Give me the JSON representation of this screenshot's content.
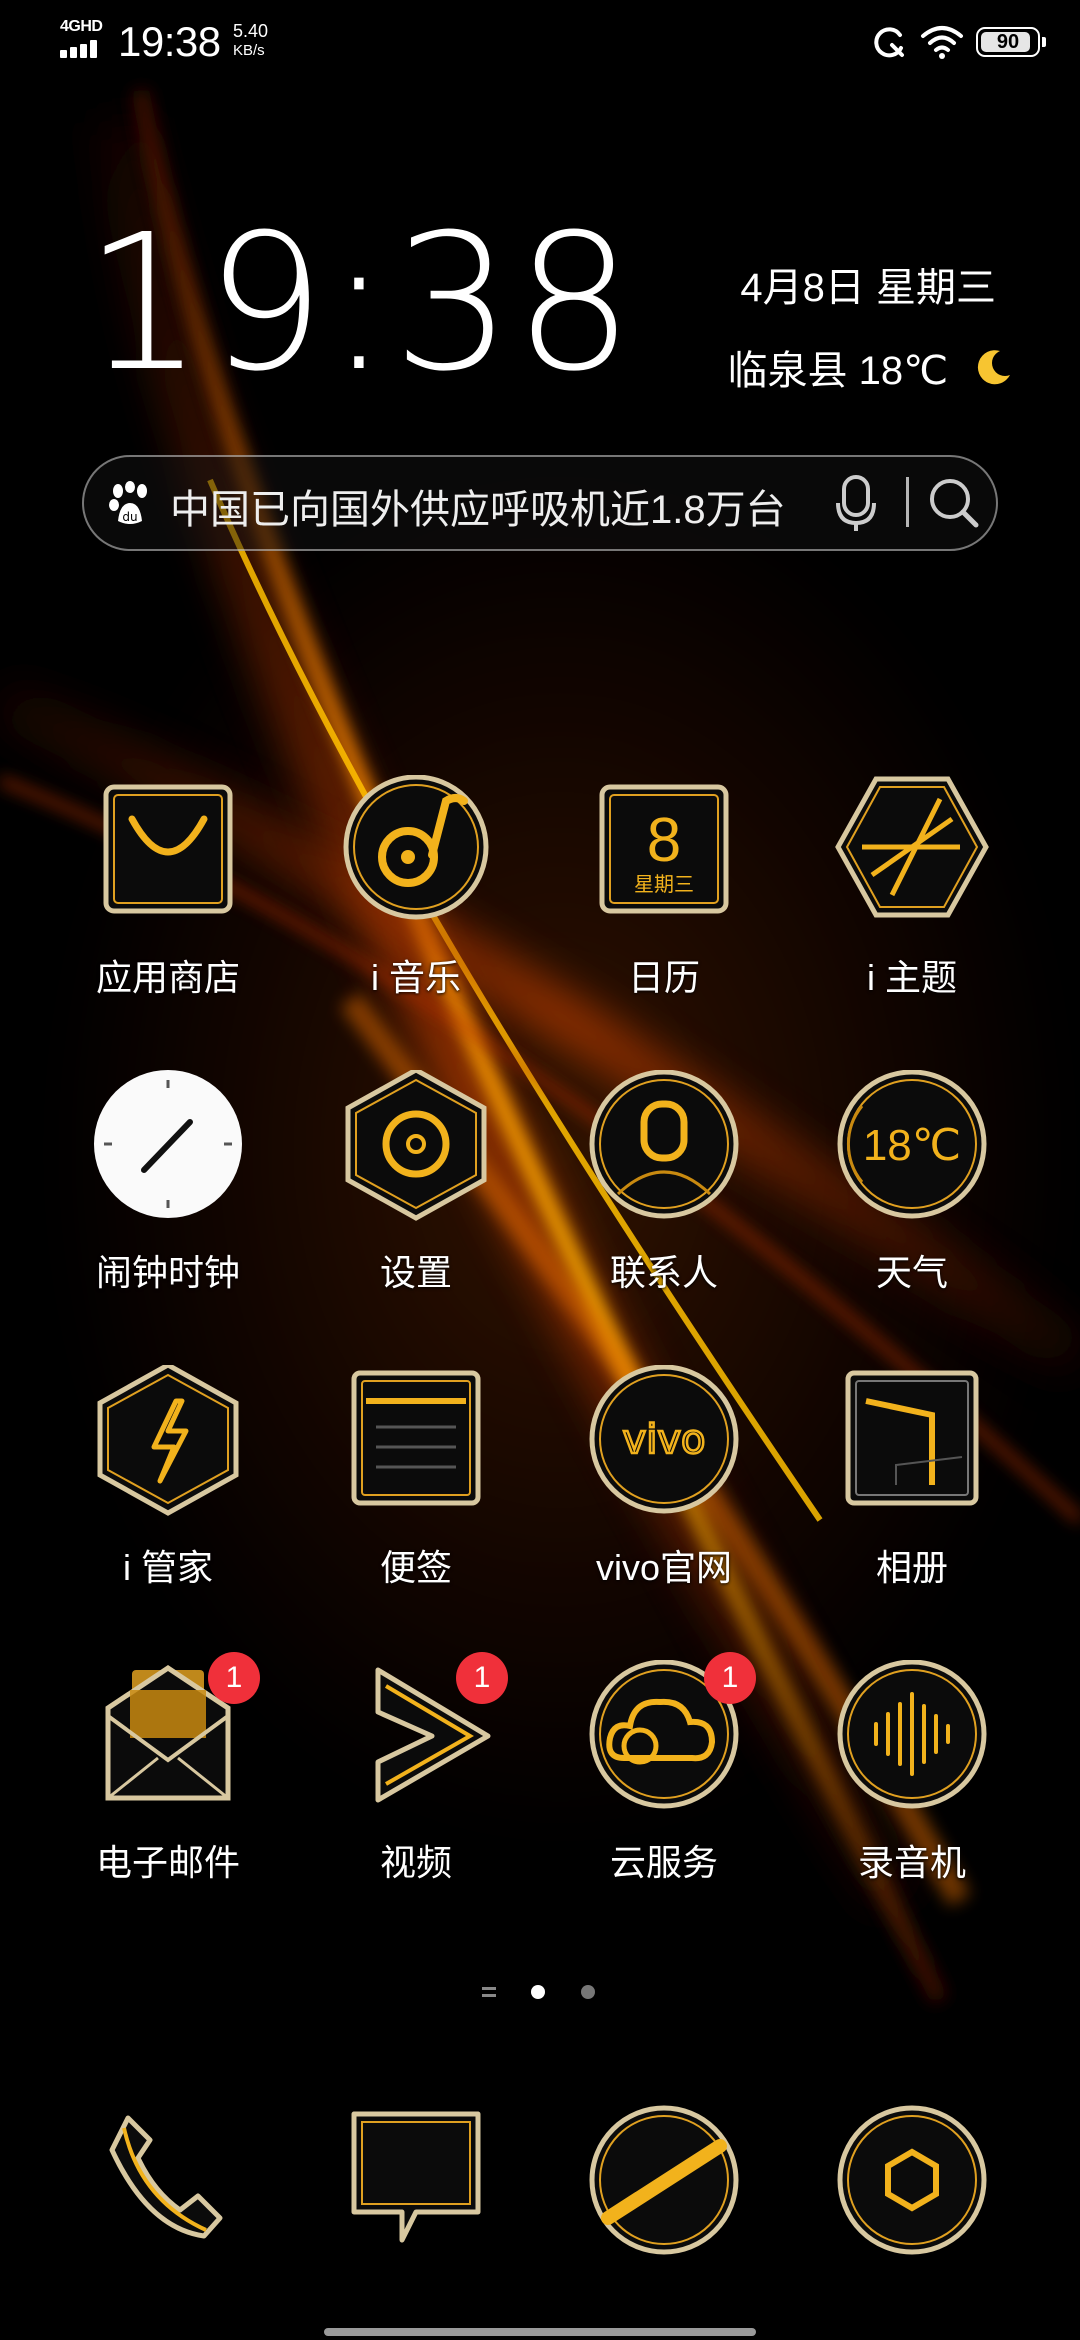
{
  "status_bar": {
    "network_type": "4GHD",
    "time": "19:38",
    "net_speed_value": "5.40",
    "net_speed_unit": "KB/s",
    "battery_level": 90,
    "battery_text": "90"
  },
  "clock_widget": {
    "time": "19:38",
    "date": "4月8日 星期三",
    "location_weather": "临泉县 18℃",
    "weather_icon": "moon-icon"
  },
  "search": {
    "query": "中国已向国外供应呼吸机近1.8万台",
    "left_icon": "baidu-paw-icon",
    "voice_icon": "microphone-icon",
    "search_icon": "search-icon"
  },
  "apps": [
    {
      "label": "应用商店",
      "icon": "shopping-bag-icon"
    },
    {
      "label": "i 音乐",
      "icon": "music-disc-icon"
    },
    {
      "label": "日历",
      "icon": "calendar-icon",
      "calendar_day": "8",
      "calendar_weekday": "星期三"
    },
    {
      "label": "i 主题",
      "icon": "theme-hexagon-icon"
    },
    {
      "label": "闹钟时钟",
      "icon": "clock-icon"
    },
    {
      "label": "设置",
      "icon": "settings-icon"
    },
    {
      "label": "联系人",
      "icon": "contacts-icon"
    },
    {
      "label": "天气",
      "icon": "weather-icon",
      "temp": "18℃"
    },
    {
      "label": "i 管家",
      "icon": "lightning-icon"
    },
    {
      "label": "便签",
      "icon": "notes-icon"
    },
    {
      "label": "vivo官网",
      "icon": "vivo-logo-icon",
      "logo_text": "vivo"
    },
    {
      "label": "相册",
      "icon": "gallery-icon"
    },
    {
      "label": "电子邮件",
      "icon": "email-icon",
      "badge": "1"
    },
    {
      "label": "视频",
      "icon": "video-play-icon",
      "badge": "1"
    },
    {
      "label": "云服务",
      "icon": "cloud-icon",
      "badge": "1"
    },
    {
      "label": "录音机",
      "icon": "recorder-icon"
    }
  ],
  "page_indicator": {
    "pages": 3,
    "current": 2
  },
  "dock": [
    {
      "icon": "phone-icon"
    },
    {
      "icon": "message-icon"
    },
    {
      "icon": "browser-icon"
    },
    {
      "icon": "camera-icon"
    }
  ],
  "colors": {
    "gold": "#f2b21c",
    "gold_dark": "#c98a10",
    "badge_red": "#f0303a"
  }
}
